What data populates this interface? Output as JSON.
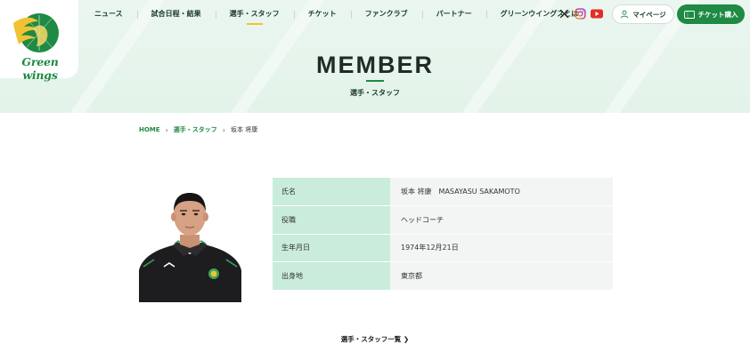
{
  "brand": {
    "logo_text": "Green wings"
  },
  "nav": {
    "items": [
      {
        "label": "ニュース"
      },
      {
        "label": "試合日程・結果"
      },
      {
        "label": "選手・スタッフ"
      },
      {
        "label": "チケット"
      },
      {
        "label": "ファンクラブ"
      },
      {
        "label": "パートナー"
      },
      {
        "label": "グリーンウイングスとは"
      }
    ],
    "active_index": 2
  },
  "social": {
    "icons": [
      "x-icon",
      "instagram-icon",
      "youtube-icon"
    ]
  },
  "header_buttons": {
    "mypage_label": "マイページ",
    "ticket_label": "チケット購入"
  },
  "hero": {
    "title": "MEMBER",
    "subtitle": "選手・スタッフ"
  },
  "breadcrumb": {
    "home": "HOME",
    "section": "選手・スタッフ",
    "current": "坂本 将康"
  },
  "profile": {
    "rows": [
      {
        "key": "氏名",
        "value": "坂本 将康　MASAYASU SAKAMOTO"
      },
      {
        "key": "役職",
        "value": "ヘッドコーチ"
      },
      {
        "key": "生年月日",
        "value": "1974年12月21日"
      },
      {
        "key": "出身地",
        "value": "東京都"
      }
    ]
  },
  "back_link": {
    "label": "選手・スタッフ一覧",
    "arrow": "❯"
  },
  "colors": {
    "brand_green": "#1e8a43",
    "table_key_bg": "#c9ecdb",
    "table_val_bg": "#f3f5f4",
    "nav_active_underline": "#f1c232"
  }
}
